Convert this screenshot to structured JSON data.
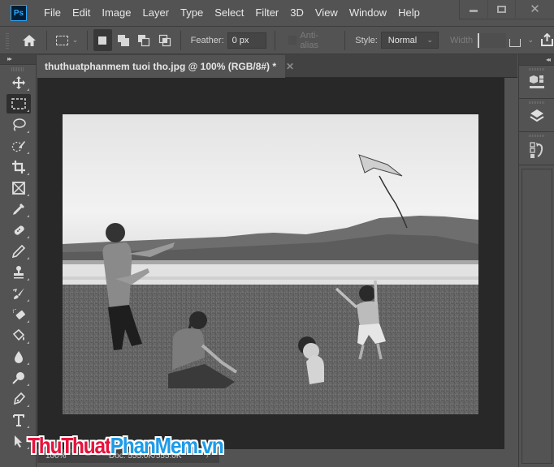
{
  "app": {
    "logo": "Ps",
    "menu": [
      "File",
      "Edit",
      "Image",
      "Layer",
      "Type",
      "Select",
      "Filter",
      "3D",
      "View",
      "Window",
      "Help"
    ],
    "window_controls": {
      "minimize": "minimize-icon",
      "maximize": "maximize-icon",
      "close": "✕"
    }
  },
  "options_bar": {
    "home": "home-icon",
    "tool_preset": "rectangular-marquee-icon",
    "selection_modes": [
      {
        "name": "new-selection",
        "active": true
      },
      {
        "name": "add-to-selection",
        "active": false
      },
      {
        "name": "subtract-from-selection",
        "active": false
      },
      {
        "name": "intersect-with-selection",
        "active": false
      }
    ],
    "feather_label": "Feather:",
    "feather_value": "0 px",
    "antialias_label": "Anti-alias",
    "style_label": "Style:",
    "style_value": "Normal",
    "width_label": "Width",
    "share": "share-icon"
  },
  "toolbar": {
    "collapse": "▸▸",
    "tools": [
      {
        "name": "move-tool",
        "active": false
      },
      {
        "name": "rectangular-marquee-tool",
        "active": true
      },
      {
        "name": "lasso-tool",
        "active": false
      },
      {
        "name": "quick-selection-tool",
        "active": false
      },
      {
        "name": "crop-tool",
        "active": false
      },
      {
        "name": "frame-tool",
        "active": false
      },
      {
        "name": "eyedropper-tool",
        "active": false
      },
      {
        "name": "spot-healing-brush-tool",
        "active": false
      },
      {
        "name": "brush-tool",
        "active": false
      },
      {
        "name": "clone-stamp-tool",
        "active": false
      },
      {
        "name": "history-brush-tool",
        "active": false
      },
      {
        "name": "eraser-tool",
        "active": false
      },
      {
        "name": "paint-bucket-tool",
        "active": false
      },
      {
        "name": "blur-tool",
        "active": false
      },
      {
        "name": "dodge-tool",
        "active": false
      },
      {
        "name": "pen-tool",
        "active": false
      },
      {
        "name": "type-tool",
        "active": false
      },
      {
        "name": "path-selection-tool",
        "active": false
      }
    ]
  },
  "document": {
    "tab_title": "thuthuatphanmem tuoi tho.jpg @ 100% (RGB/8#) *",
    "close": "✕",
    "image_description": "Black and white photo: a young man flying a kite, a girl sitting on grass, two small children, lake and hills in background"
  },
  "status_bar": {
    "zoom": "100%",
    "doc_size": "Doc: 555.0K/555.0K",
    "arrow": "›"
  },
  "right_dock": {
    "collapse": "◂◂",
    "panels": [
      "libraries-icon",
      "layers-icon",
      "history-icon"
    ]
  },
  "watermark": {
    "part1": "ThuThuat",
    "part2": "PhanMem.vn"
  }
}
